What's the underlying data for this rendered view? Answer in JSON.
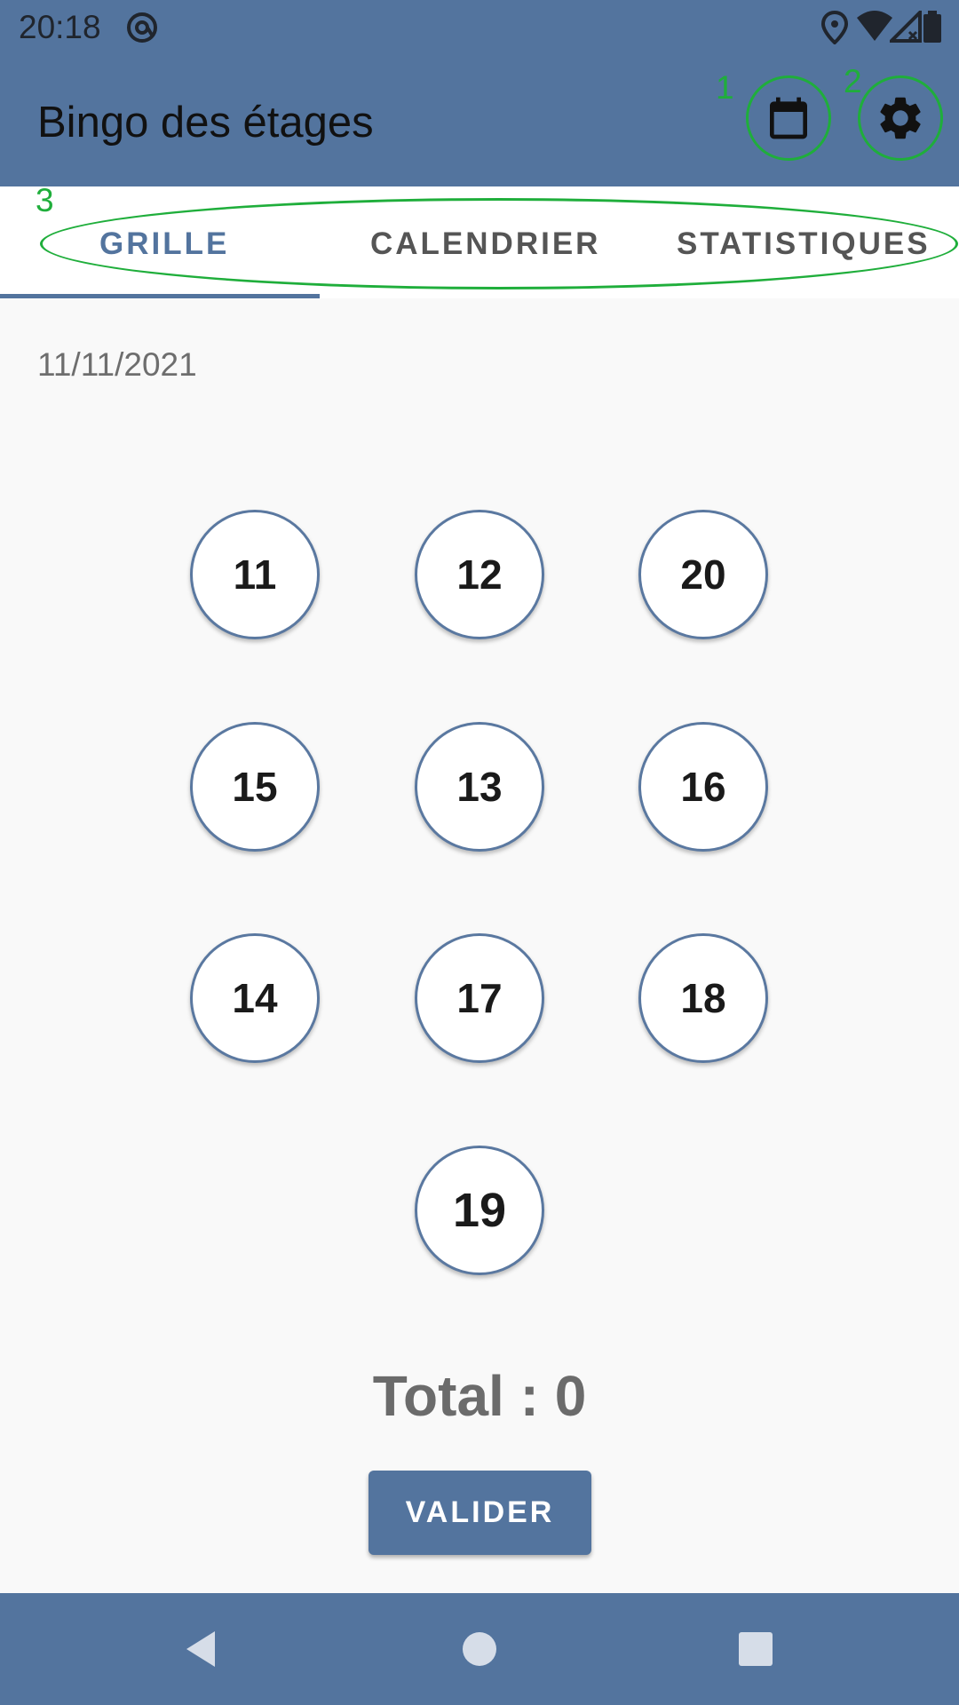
{
  "status_bar": {
    "time": "20:18",
    "icons": [
      "at-sign-icon",
      "location-icon",
      "wifi-icon",
      "signal-icon",
      "battery-icon"
    ]
  },
  "app_bar": {
    "title": "Bingo des étages",
    "actions": [
      {
        "name": "calendar-icon",
        "marker": "1"
      },
      {
        "name": "gear-icon",
        "marker": "2"
      }
    ]
  },
  "tabs": {
    "marker": "3",
    "items": [
      {
        "label": "GRILLE",
        "active": true
      },
      {
        "label": "CALENDRIER",
        "active": false
      },
      {
        "label": "STATISTIQUES",
        "active": false
      }
    ]
  },
  "main": {
    "date": "11/11/2021",
    "grid": [
      "11",
      "12",
      "20",
      "15",
      "13",
      "16",
      "14",
      "17",
      "18",
      "19"
    ],
    "total": "Total : 0",
    "valider_label": "VALIDER"
  },
  "nav_bar": {
    "buttons": [
      "back-icon",
      "home-icon",
      "recents-icon"
    ]
  },
  "colors": {
    "primary": "#53749e",
    "annotation": "#1fae3b",
    "background": "#f9f9f9"
  }
}
